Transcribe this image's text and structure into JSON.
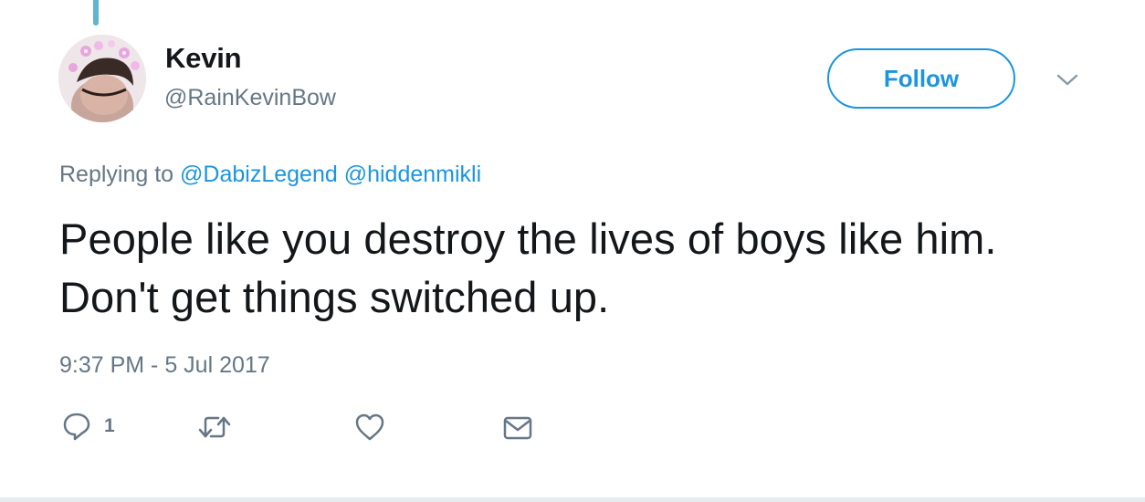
{
  "user": {
    "name": "Kevin",
    "handle": "@RainKevinBow"
  },
  "follow_label": "Follow",
  "replying": {
    "prefix": "Replying to",
    "mentions": [
      "@DabizLegend",
      "@hiddenmikli"
    ]
  },
  "tweet": {
    "text": "People like you destroy the lives of boys like him. Don't get things switched up.",
    "timestamp": "9:37 PM - 5 Jul 2017"
  },
  "actions": {
    "reply_count": "1"
  },
  "icons": {
    "reply": "reply-icon",
    "retweet": "retweet-icon",
    "like": "heart-icon",
    "message": "envelope-icon",
    "more": "chevron-down-icon"
  },
  "colors": {
    "link": "#1b95e0",
    "secondary_text": "#657786",
    "primary_text": "#14171a",
    "thread_line": "#61b4d1"
  }
}
